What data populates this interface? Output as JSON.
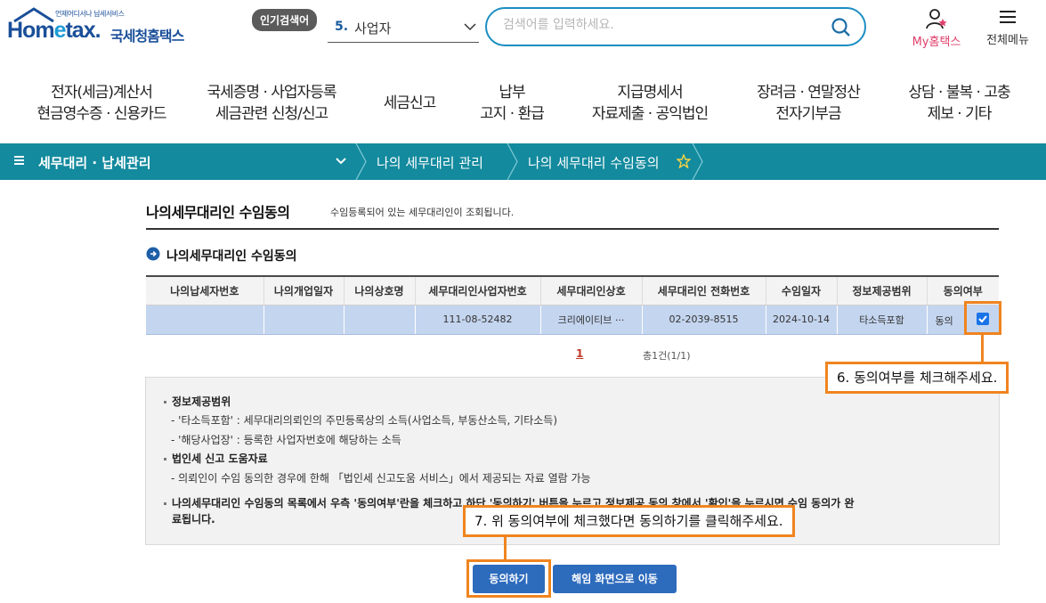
{
  "header": {
    "logo_small": "언제어디서나 납세서비스",
    "logo_main_a": "Hom",
    "logo_main_e": "e",
    "logo_main_b": "tax.",
    "logo_kr": "국세청홈택스",
    "popular_badge": "인기검색어",
    "popular_rank": "5.",
    "popular_term": "사업자",
    "search_placeholder": "검색어를 입력하세요.",
    "my_hometax": "My홈택스",
    "all_menu": "전체메뉴"
  },
  "gnb": [
    {
      "line1": "전자(세금)계산서",
      "line2": "현금영수증 · 신용카드"
    },
    {
      "line1": "국세증명 · 사업자등록",
      "line2": "세금관련 신청/신고"
    },
    {
      "line1": "세금신고",
      "line2": ""
    },
    {
      "line1": "납부",
      "line2": "고지 · 환급"
    },
    {
      "line1": "지급명세서",
      "line2": "자료제출 · 공익법인"
    },
    {
      "line1": "장려금 · 연말정산",
      "line2": "전자기부금"
    },
    {
      "line1": "상담 · 불복 · 고충",
      "line2": "제보 · 기타"
    }
  ],
  "breadcrumb": {
    "level1": "세무대리 · 납세관리",
    "level2": "나의 세무대리 관리",
    "level3": "나의 세무대리 수임동의"
  },
  "page": {
    "title": "나의세무대리인 수임동의",
    "description": "수임등록되어 있는 세무대리인이 조회됩니다.",
    "section_title": "나의세무대리인 수임동의"
  },
  "table": {
    "headers": [
      "나의납세자번호",
      "나의개업일자",
      "나의상호명",
      "세무대리인사업자번호",
      "세무대리인상호",
      "세무대리인 전화번호",
      "수임일자",
      "정보제공범위",
      "동의여부"
    ],
    "rows": [
      {
        "taxpayer_no": "",
        "open_date": "",
        "trade_name": "",
        "agent_biz_no": "111-08-52482",
        "agent_name": "크리에이티브 ···",
        "agent_phone": "02-2039-8515",
        "date": "2024-10-14",
        "scope": "타소득포함",
        "agree": "동의",
        "checked": true
      }
    ]
  },
  "pager": {
    "current": "1",
    "total": "총1건(1/1)"
  },
  "info": {
    "h1": "정보제공범위",
    "l1": "- '타소득포함' : 세무대리의뢰인의 주민등록상의 소득(사업소득, 부동산소득, 기타소득)",
    "l2": "- '해당사업장' : 등록한 사업자번호에 해당하는 소득",
    "h2": "법인세 신고 도움자료",
    "l3": "- 의뢰인이 수임 동의한 경우에 한해 「법인세 신고도움 서비스」에서 제공되는 자료 열람 가능",
    "h3a": "나의세무대리인 수임동의 목록에서 우측 '동의여부'란을 체크하고 하단 '동의하기' 버튼을 누르고 정보제공 동의 창에서 '확인'을 누르시면 수임 동의가 완",
    "h3b": "료됩니다."
  },
  "buttons": {
    "agree": "동의하기",
    "cancel": "해임 화면으로 이동"
  },
  "annotations": {
    "step6": "6. 동의여부를 체크해주세요.",
    "step7": "7. 위 동의여부에 체크했다면 동의하기를 클릭해주세요."
  },
  "colors": {
    "brand": "#1a4f99",
    "teal_bar": "#138a9e",
    "highlight": "#f0841f",
    "button": "#2d6bbd",
    "row_selected": "#c4d5ef"
  }
}
